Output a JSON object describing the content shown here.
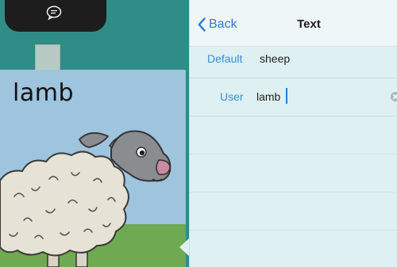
{
  "card": {
    "word": "lamb",
    "colors": {
      "sky": "#9ec4de",
      "grass": "#6faa52",
      "wool": "#e6e2d6",
      "face": "#8a8d90",
      "nose": "#cc8aa0"
    }
  },
  "app": {
    "top_icon": "chat-bubble-icon",
    "background": "#2f8c86"
  },
  "panel": {
    "back_label": "Back",
    "title": "Text",
    "rows": [
      {
        "label": "Default",
        "value": "sheep"
      },
      {
        "label": "User",
        "value": "lamb"
      }
    ],
    "accent": "#2b7bd6",
    "label_color": "#3a8ed2"
  }
}
